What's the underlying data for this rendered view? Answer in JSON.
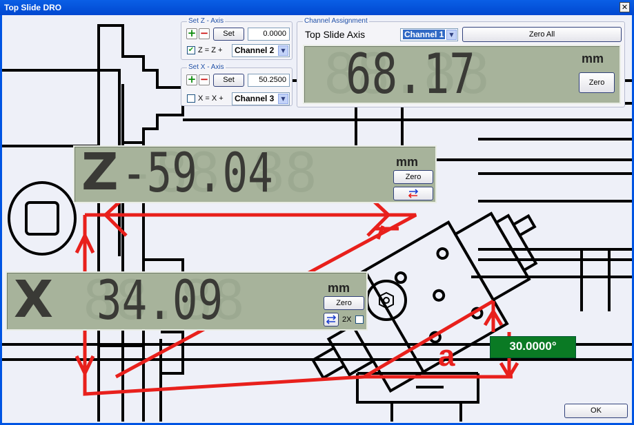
{
  "window": {
    "title": "Top Slide DRO",
    "close_glyph": "✕"
  },
  "set_z": {
    "group_label": "Set Z - Axis",
    "plus_glyph": "+",
    "minus_glyph": "−",
    "set_label": "Set",
    "value": "0.0000",
    "equation": "Z = Z +",
    "checked": true,
    "check_glyph": "✔",
    "channel": "Channel 2"
  },
  "set_x": {
    "group_label": "Set X - Axis",
    "plus_glyph": "+",
    "minus_glyph": "−",
    "set_label": "Set",
    "value": "50.2500",
    "equation": "X = X +",
    "checked": false,
    "channel": "Channel 3"
  },
  "channel_assignment": {
    "group_label": "Channel Assignment",
    "axis_label": "Top Slide Axis",
    "channel": "Channel 1",
    "zero_all_label": "Zero All",
    "dro_value": "68.17",
    "unit": "mm",
    "zero_label": "Zero"
  },
  "z_dro": {
    "axis": "Z",
    "value": "-59.04",
    "unit": "mm",
    "zero_label": "Zero",
    "swap_icon": "swap-direction-icon"
  },
  "x_dro": {
    "axis": "X",
    "value": "34.09",
    "unit": "mm",
    "zero_label": "Zero",
    "diameter_label": "2X",
    "diameter_checked": false,
    "swap_icon": "swap-direction-icon"
  },
  "diagram": {
    "angle": "30.0000°",
    "angle_symbol": "a"
  },
  "footer": {
    "ok_label": "OK"
  },
  "colors": {
    "lcd": "#a7b39b",
    "accent_red": "#e8201c",
    "angle_green": "#0a7a24",
    "titlebar": "#0054e3"
  },
  "dropdown_arrow": "▼"
}
